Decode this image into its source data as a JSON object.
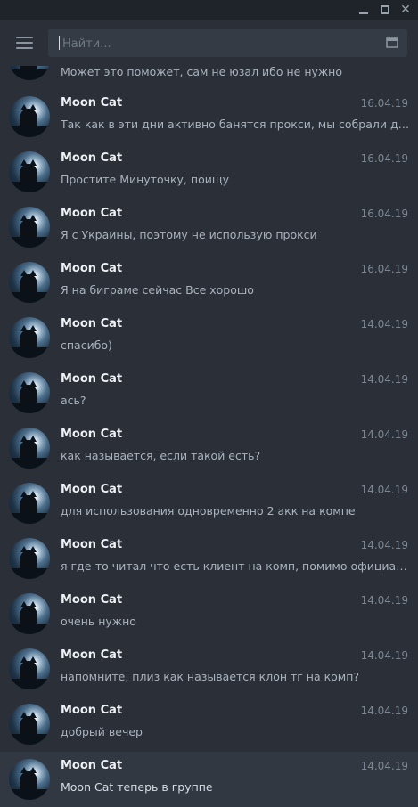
{
  "search": {
    "placeholder": "Найти..."
  },
  "chats": [
    {
      "name": "",
      "date": "",
      "preview": "Может это поможет, сам не юзал ибо не нужно"
    },
    {
      "name": "Moon Cat",
      "date": "16.04.19",
      "preview": "Так как в эти дни активно банятся прокси, мы собрали для ва..."
    },
    {
      "name": "Moon Cat",
      "date": "16.04.19",
      "preview": "Простите Минуточку, поищу"
    },
    {
      "name": "Moon Cat",
      "date": "16.04.19",
      "preview": "Я с Украины, поэтому не использую прокси"
    },
    {
      "name": "Moon Cat",
      "date": "16.04.19",
      "preview": "Я на биграме сейчас Все хорошо"
    },
    {
      "name": "Moon Cat",
      "date": "14.04.19",
      "preview": "спасибо)"
    },
    {
      "name": "Moon Cat",
      "date": "14.04.19",
      "preview": "ась?"
    },
    {
      "name": "Moon Cat",
      "date": "14.04.19",
      "preview": "как называется, если такой есть?"
    },
    {
      "name": "Moon Cat",
      "date": "14.04.19",
      "preview": "для использования одновременно 2 акк на компе"
    },
    {
      "name": "Moon Cat",
      "date": "14.04.19",
      "preview": "я где-то читал что есть клиент на комп, помимо официально..."
    },
    {
      "name": "Moon Cat",
      "date": "14.04.19",
      "preview": "очень нужно"
    },
    {
      "name": "Moon Cat",
      "date": "14.04.19",
      "preview": "напомните, плиз как называется клон тг на комп?"
    },
    {
      "name": "Moon Cat",
      "date": "14.04.19",
      "preview": "добрый вечер"
    },
    {
      "name": "Moon Cat",
      "date": "14.04.19",
      "preview": "Moon Cat теперь в группе"
    }
  ]
}
